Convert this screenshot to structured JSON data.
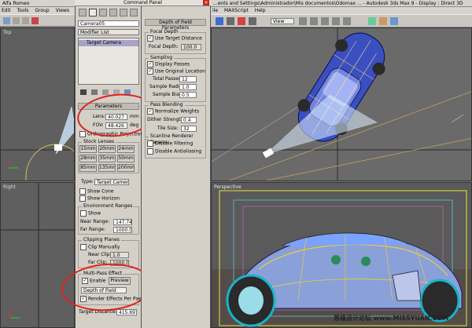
{
  "window_title": "Alfa Romeo",
  "menu": [
    "Edit",
    "Tools",
    "Group",
    "Views"
  ],
  "command_panel": {
    "title": "Command Panel",
    "object_name": "Camera05",
    "modifier_list": "Modifier List",
    "stack_item": "Target Camera",
    "parameters": {
      "header": "Parameters",
      "lens_label": "Lens:",
      "lens_value": "40.027",
      "lens_unit": "mm",
      "fov_label": "FOV:",
      "fov_value": "48.426",
      "fov_unit": "deg",
      "ortho_label": "Orthographic Projection",
      "stock_lenses_title": "Stock Lenses",
      "stock_lenses": [
        "15mm",
        "20mm",
        "24mm",
        "28mm",
        "35mm",
        "50mm",
        "85mm",
        "135mm",
        "200mm"
      ],
      "type_label": "Type:",
      "type_value": "Target Camera",
      "show_cone": "Show Cone",
      "show_horizon": "Show Horizon",
      "env_ranges_title": "Environment Ranges",
      "env_show": "Show",
      "near_range_label": "Near Range:",
      "near_range_value": "147.74",
      "far_range_label": "Far Range:",
      "far_range_value": "1000.0",
      "clipping_title": "Clipping Planes",
      "clip_manually": "Clip Manually",
      "near_clip_label": "Near Clip:",
      "near_clip_value": "1.0",
      "far_clip_label": "Far Clip:",
      "far_clip_value": "1000.0",
      "multipass_title": "Multi-Pass Effect",
      "enable_label": "Enable",
      "preview_label": "Preview",
      "effect_value": "Depth of Field",
      "render_effects_label": "Render Effects Per Pass",
      "target_distance_label": "Target Distance:",
      "target_distance_value": "415.697"
    }
  },
  "dof_panel": {
    "header": "Depth of Field Parameters",
    "focal_depth_title": "Focal Depth",
    "use_target_distance": "Use Target Distance",
    "focal_depth_label": "Focal Depth:",
    "focal_depth_value": "100.0",
    "sampling_title": "Sampling",
    "display_passes": "Display Passes",
    "use_original_location": "Use Original Location",
    "total_passes_label": "Total Passes:",
    "total_passes_value": "12",
    "sample_radius_label": "Sample Radius:",
    "sample_radius_value": "1.0",
    "sample_bias_label": "Sample Bias:",
    "sample_bias_value": "0.5",
    "pass_blending_title": "Pass Blending",
    "normalize_weights": "Normalize Weights",
    "dither_strength_label": "Dither Strength:",
    "dither_strength_value": "0.4",
    "tile_size_label": "Tile Size:",
    "tile_size_value": "32",
    "scanline_title": "Scanline Renderer Params",
    "disable_filtering": "Disable Filtering",
    "disable_antialiasing": "Disable Antialiasing"
  },
  "main_window": {
    "title": "...ents and Settings\\Administrador\\Mis documentos\\Odomax ... - Autodesk 3ds Max 9 - Display : Direct 3D",
    "menu": [
      "ile",
      "MAXScript",
      "Help"
    ],
    "view_dropdown": "View"
  },
  "viewports": {
    "top_label": "Top",
    "right_label": "Right",
    "perspective_label": "Perspective"
  },
  "watermark": "思缘设计论坛 www.MISSYUAN.COM",
  "colors": {
    "annotation": "#e0231d",
    "car_body": "#4a62c8",
    "wireframe": "#f0d040",
    "safe_frame": "#e8e83a"
  }
}
